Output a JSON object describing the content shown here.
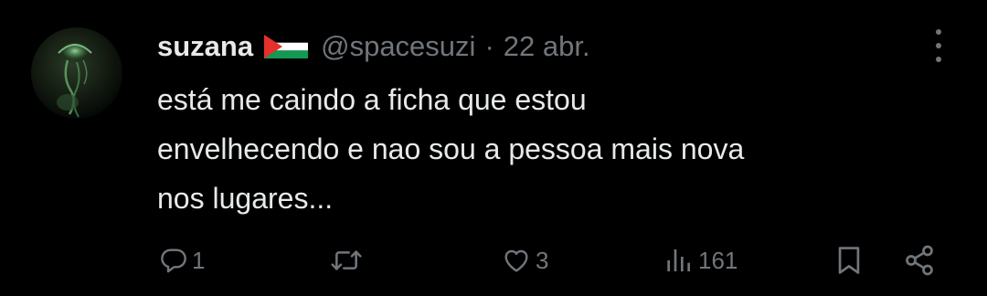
{
  "tweet": {
    "display_name": "suzana",
    "handle": "@spacesuzi",
    "separator": "·",
    "date": "22 abr.",
    "text_lines": [
      "está me caindo a ficha que estou",
      "envelhecendo e nao sou a pessoa mais nova",
      "nos lugares..."
    ],
    "flag_icon": "palestine-flag-icon",
    "avatar_icon": "jellyfish-avatar"
  },
  "actions": {
    "reply": {
      "icon": "reply-icon",
      "count": "1"
    },
    "retweet": {
      "icon": "retweet-icon",
      "count": ""
    },
    "like": {
      "icon": "heart-icon",
      "count": "3"
    },
    "views": {
      "icon": "views-icon",
      "count": "161"
    },
    "bookmark": {
      "icon": "bookmark-icon"
    },
    "share": {
      "icon": "share-icon"
    }
  },
  "colors": {
    "background": "#000000",
    "primary_text": "#e7e9ea",
    "secondary_text": "#71767b",
    "flag_black": "#000000",
    "flag_white": "#ffffff",
    "flag_green": "#149954",
    "flag_red": "#e4312b"
  }
}
